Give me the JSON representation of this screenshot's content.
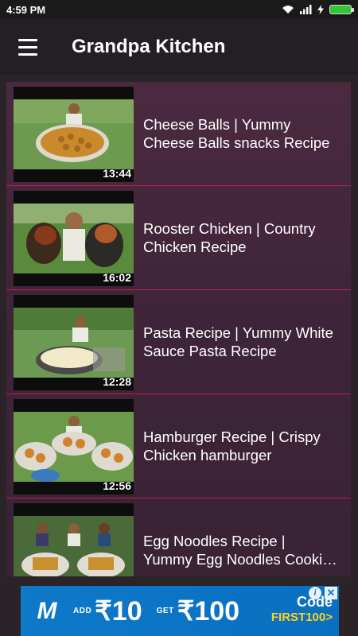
{
  "status_bar": {
    "time": "4:59 PM",
    "icons": [
      "wifi-icon",
      "signal-icon",
      "charging-icon",
      "battery-icon"
    ]
  },
  "app_bar": {
    "title": "Grandpa Kitchen",
    "menu_icon": "hamburger-menu-icon"
  },
  "videos": [
    {
      "title_line1": "Cheese Balls | Yummy",
      "title_line2": "Cheese Balls snacks Recipe",
      "duration": "13:44"
    },
    {
      "title_line1": "Rooster Chicken | Country",
      "title_line2": "Chicken Recipe",
      "duration": "16:02"
    },
    {
      "title_line1": "Pasta Recipe | Yummy White",
      "title_line2": "Sauce Pasta Recipe",
      "duration": "12:28"
    },
    {
      "title_line1": "Hamburger Recipe | Crispy",
      "title_line2": "Chicken hamburger",
      "duration": "12:56"
    },
    {
      "title_line1": "Egg Noodles Recipe |",
      "title_line2": "Yummy Egg Noodles Cooki…",
      "duration": ""
    }
  ],
  "ad": {
    "logo": "M",
    "offer1_label": "ADD",
    "offer1_value": "₹10",
    "offer2_label": "GET",
    "offer2_value": "₹100",
    "code_label": "Code",
    "code_value": "FIRST100>",
    "info_icon": "info-icon",
    "close_icon": "close-icon"
  },
  "colors": {
    "accent_divider": "#c2185b",
    "app_bar_bg": "#241f24",
    "list_bg": "#4b2a40",
    "ad_bg": "#0e79c9",
    "ad_code": "#ffd21c"
  }
}
